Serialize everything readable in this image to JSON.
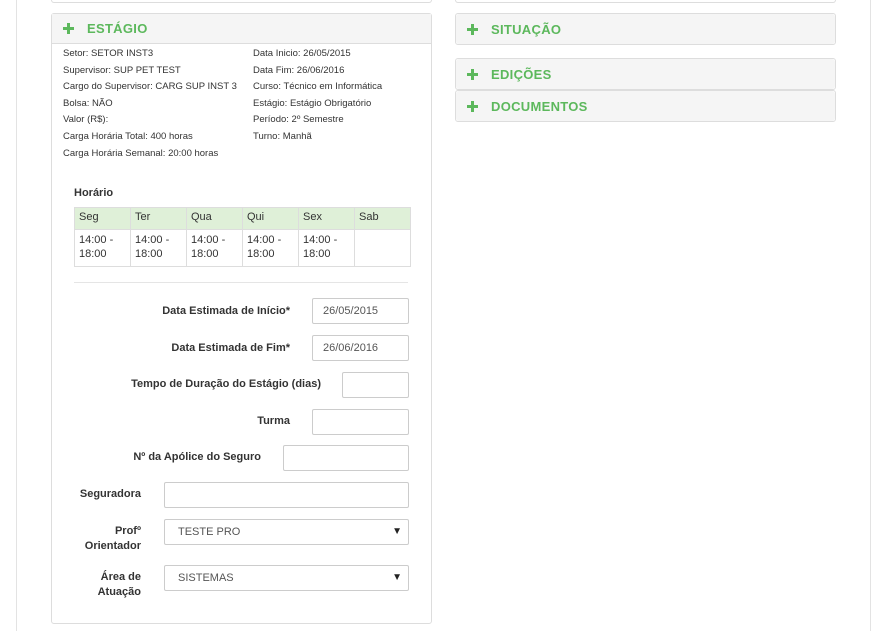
{
  "panels": {
    "estagio": "ESTÁGIO",
    "situacao": "SITUAÇÃO",
    "edicoes": "EDIÇÕES",
    "documentos": "DOCUMENTOS"
  },
  "info_left": [
    "Setor: SETOR INST3",
    "Supervisor: SUP PET TEST",
    "Cargo do Supervisor: CARG SUP INST 3",
    "Bolsa: NÃO",
    "Valor (R$):",
    "Carga Horária Total: 400 horas",
    "Carga Horária Semanal: 20:00 horas"
  ],
  "info_right": [
    "Data Inicio: 26/05/2015",
    "Data Fim: 26/06/2016",
    "Curso: Técnico em Informática",
    "Estágio: Estágio Obrigatório",
    "Período: 2º Semestre",
    "Turno: Manhã"
  ],
  "horario": {
    "title": "Horário",
    "days": [
      "Seg",
      "Ter",
      "Qua",
      "Qui",
      "Sex",
      "Sab"
    ],
    "times": [
      "14:00 - 18:00",
      "14:00 - 18:00",
      "14:00 - 18:00",
      "14:00 - 18:00",
      "14:00 - 18:00",
      ""
    ]
  },
  "form": {
    "data_inicio_label": "Data Estimada de Início*",
    "data_inicio_value": "26/05/2015",
    "data_fim_label": "Data Estimada de Fim*",
    "data_fim_value": "26/06/2016",
    "duracao_label": "Tempo de Duração do Estágio (dias)",
    "duracao_value": "",
    "turma_label": "Turma",
    "turma_value": "",
    "apolice_label": "Nº da Apólice do Seguro",
    "apolice_value": "",
    "seguradora_label": "Seguradora",
    "seguradora_value": "",
    "prof_label_1": "Profº",
    "prof_label_2": "Orientador",
    "prof_value": "TESTE PRO",
    "area_label_1": "Área de",
    "area_label_2": "Atuação",
    "area_value": "SISTEMAS"
  }
}
